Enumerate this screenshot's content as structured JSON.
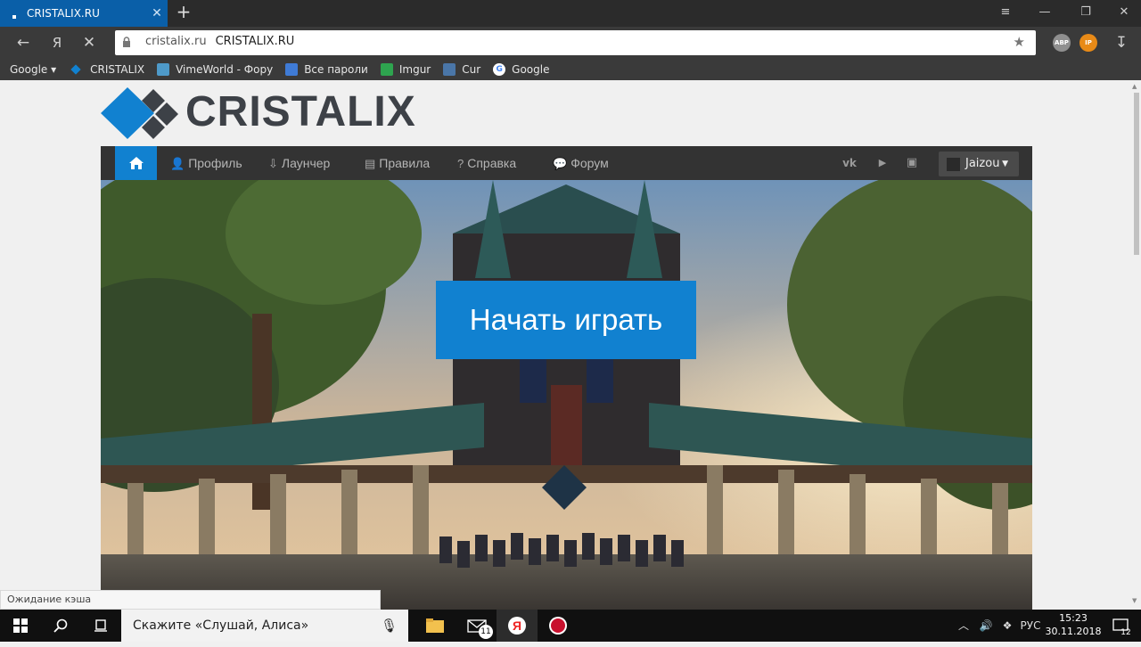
{
  "browser": {
    "tab_title": "CRISTALIX.RU",
    "tab_close": "✕",
    "new_tab": "+",
    "window_menu": "≡",
    "window_min": "—",
    "window_restore": "❐",
    "window_close": "✕",
    "address_domain": "cristalix.ru",
    "address_title": "CRISTALIX.RU",
    "yandex_button": "Я",
    "extensions": [
      {
        "label": "ABP",
        "color": "#8f8f8f"
      },
      {
        "label": "IP",
        "color": "#e88a17"
      }
    ]
  },
  "bookmarks": [
    {
      "label": "Google ▾",
      "icon": "none"
    },
    {
      "label": "CRISTALIX",
      "icon": "cristalix-diamond",
      "color": "#1181d0"
    },
    {
      "label": "VimeWorld - Фору",
      "icon": "vimeworld-icon",
      "color": "#4e9ac9"
    },
    {
      "label": "Все пароли",
      "icon": "document-icon",
      "color": "#3f7bd6"
    },
    {
      "label": "Imgur",
      "icon": "imgur-icon",
      "color": "#2ea44f"
    },
    {
      "label": "Cur",
      "icon": "vk-icon",
      "color": "#4a76a8"
    },
    {
      "label": "Google",
      "icon": "google-icon",
      "color": "#ffffff"
    }
  ],
  "site": {
    "logo_text": "CRISTALIX",
    "nav": {
      "items": [
        {
          "label": "Профиль",
          "icon": "user-icon"
        },
        {
          "label": "Лаунчер",
          "icon": "download-icon"
        },
        {
          "label": "Правила",
          "icon": "document-icon"
        },
        {
          "label": "Справка",
          "icon": "question-icon"
        },
        {
          "label": "Форум",
          "icon": "chat-icon"
        }
      ],
      "social": [
        {
          "label": "vk",
          "icon": "vk-icon"
        },
        {
          "label": "▶",
          "icon": "youtube-icon"
        },
        {
          "label": "▣",
          "icon": "discord-icon"
        }
      ],
      "user_name": "Jaizou"
    },
    "cta_label": "Начать играть"
  },
  "status_text": "Ожидание кэша",
  "taskbar": {
    "search_placeholder": "Скажите «Слушай, Алиса»",
    "mail_badge": "11",
    "language": "РУС",
    "time": "15:23",
    "date": "30.11.2018",
    "notifications": "12"
  }
}
